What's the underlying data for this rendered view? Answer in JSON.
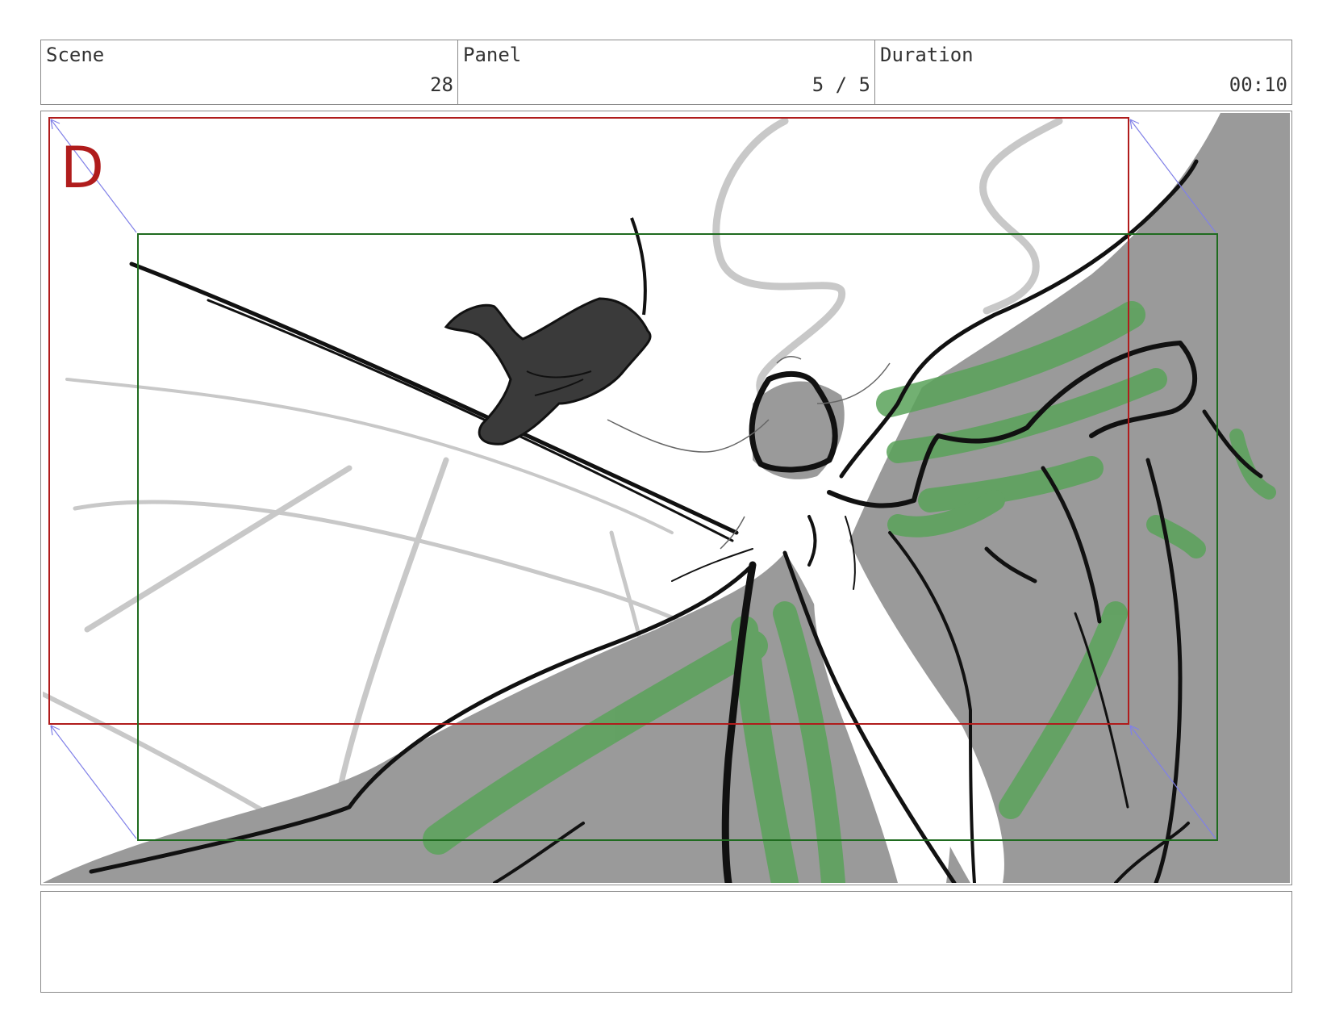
{
  "header": {
    "scene": {
      "label": "Scene",
      "value": "28"
    },
    "panel": {
      "label": "Panel",
      "value": "5 / 5"
    },
    "duration": {
      "label": "Duration",
      "value": "00:10"
    }
  },
  "panel_drawing": {
    "frame_letter": "D",
    "colors": {
      "action_safe_frame": "#b01c1c",
      "camera_frame": "#1f6b1f",
      "move_arrows": "#8080e8",
      "rock_fill": "#9a9a9a",
      "highlight_strokes": "#5aa35a",
      "ink": "#111111",
      "rough_lines": "#c8c8c8"
    }
  },
  "notes": {
    "text": ""
  }
}
